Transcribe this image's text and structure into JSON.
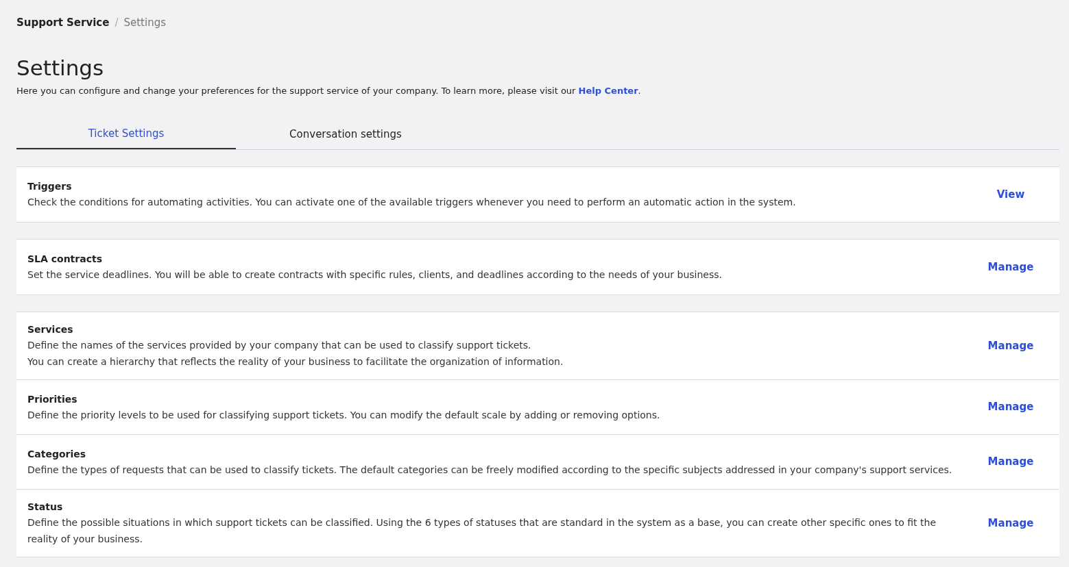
{
  "breadcrumb": [
    {
      "label": "Support Service",
      "current": false
    },
    {
      "label": "Settings",
      "current": true
    }
  ],
  "breadcrumb_separator": "/",
  "title": "Settings",
  "intro": {
    "text": "Here you can configure and change your preferences for the support service of your company. To learn more, please visit our ",
    "link": "Help Center",
    "after": "."
  },
  "tabs": [
    {
      "label": "Ticket Settings",
      "selected": true
    },
    {
      "label": "Conversation settings",
      "selected": false
    }
  ],
  "card_groups": [
    {
      "items": [
        {
          "title": "Triggers",
          "description": [
            "Check the conditions for automating activities. You can activate one of the available triggers whenever you need to perform an automatic action in the system."
          ],
          "action": "View"
        }
      ]
    },
    {
      "items": [
        {
          "title": "SLA contracts",
          "description": [
            "Set the service deadlines. You will be able to create contracts with specific rules, clients, and deadlines according to the needs of your business."
          ],
          "action": "Manage"
        }
      ]
    },
    {
      "items": [
        {
          "title": "Services",
          "description": [
            "Define the names of the services provided by your company that can be used to classify support tickets.",
            "You can create a hierarchy that reflects the reality of your business to facilitate the organization of information."
          ],
          "action": "Manage"
        },
        {
          "title": "Priorities",
          "description": [
            "Define the priority levels to be used for classifying support tickets. You can modify the default scale by adding or removing options."
          ],
          "action": "Manage"
        },
        {
          "title": "Categories",
          "description": [
            "Define the types of requests that can be used to classify tickets. The default categories can be freely modified according to the specific subjects addressed in your company's support services."
          ],
          "action": "Manage"
        },
        {
          "title": "Status",
          "description": [
            "Define the possible situations in which support tickets can be classified. Using the 6 types of statuses that are standard in the system as a base, you can create other specific ones to fit the reality of your business."
          ],
          "action": "Manage"
        }
      ]
    }
  ]
}
